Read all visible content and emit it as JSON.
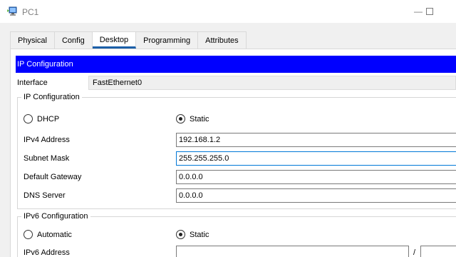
{
  "window": {
    "title": "PC1",
    "minimize_glyph": "—",
    "icon": "pc-app-icon"
  },
  "tabs": [
    {
      "label": "Physical"
    },
    {
      "label": "Config"
    },
    {
      "label": "Desktop",
      "active": true
    },
    {
      "label": "Programming"
    },
    {
      "label": "Attributes"
    }
  ],
  "header": {
    "title": "IP Configuration",
    "color": "#0000ff"
  },
  "interface": {
    "label": "Interface",
    "value": "FastEthernet0"
  },
  "ip_config": {
    "group_title": "IP Configuration",
    "mode_options": [
      {
        "label": "DHCP",
        "selected": false
      },
      {
        "label": "Static",
        "selected": true
      }
    ],
    "fields": [
      {
        "label": "IPv4 Address",
        "value": "192.168.1.2"
      },
      {
        "label": "Subnet Mask",
        "value": "255.255.255.0",
        "focused": true
      },
      {
        "label": "Default Gateway",
        "value": "0.0.0.0"
      },
      {
        "label": "DNS Server",
        "value": "0.0.0.0"
      }
    ]
  },
  "ipv6_config": {
    "group_title": "IPv6 Configuration",
    "mode_options": [
      {
        "label": "Automatic",
        "selected": false
      },
      {
        "label": "Static",
        "selected": true
      }
    ],
    "address_label": "IPv6 Address",
    "address_value": "",
    "prefix_separator": "/",
    "prefix_value": ""
  },
  "colors": {
    "active_tab_underline": "#1c5fa8",
    "focus_border": "#0078d7"
  }
}
